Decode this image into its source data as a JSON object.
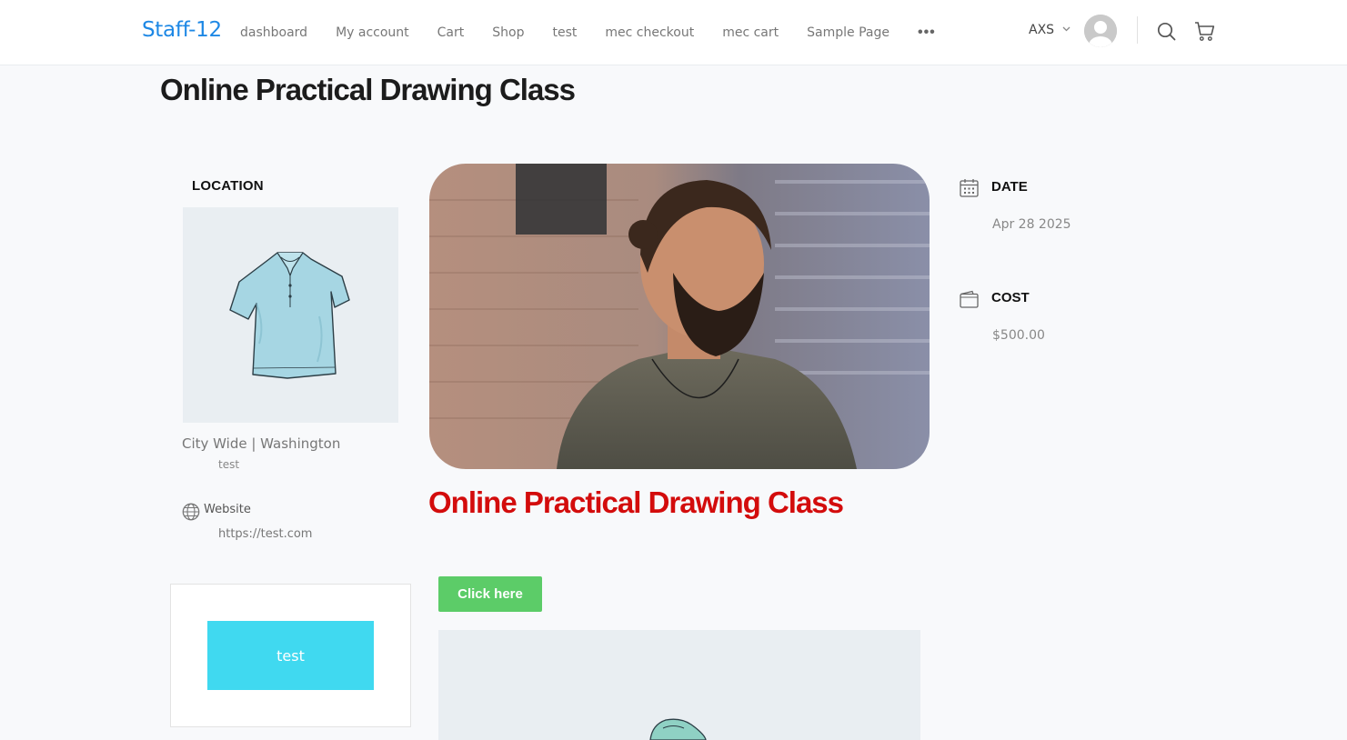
{
  "header": {
    "brand": "Staff-12",
    "nav": [
      "dashboard",
      "My account",
      "Cart",
      "Shop",
      "test",
      "mec checkout",
      "mec cart",
      "Sample Page"
    ],
    "more": "•••",
    "language": "AXS"
  },
  "page": {
    "title": "Online Practical Drawing Class"
  },
  "location": {
    "heading": "LOCATION",
    "name": "City Wide | Washington",
    "address": "test",
    "website_label": "Website",
    "website_url": "https://test.com"
  },
  "event": {
    "title": "Online Practical Drawing Class",
    "button_label": "Click here"
  },
  "widget": {
    "button_label": "test"
  },
  "details": {
    "date_label": "DATE",
    "date_value": "Apr 28 2025",
    "cost_label": "COST",
    "cost_value": "$500.00"
  },
  "colors": {
    "brand": "#1e88e5",
    "event_title": "#d30c0c",
    "cta": "#5ccc68",
    "widget_button": "#40d9f0"
  }
}
